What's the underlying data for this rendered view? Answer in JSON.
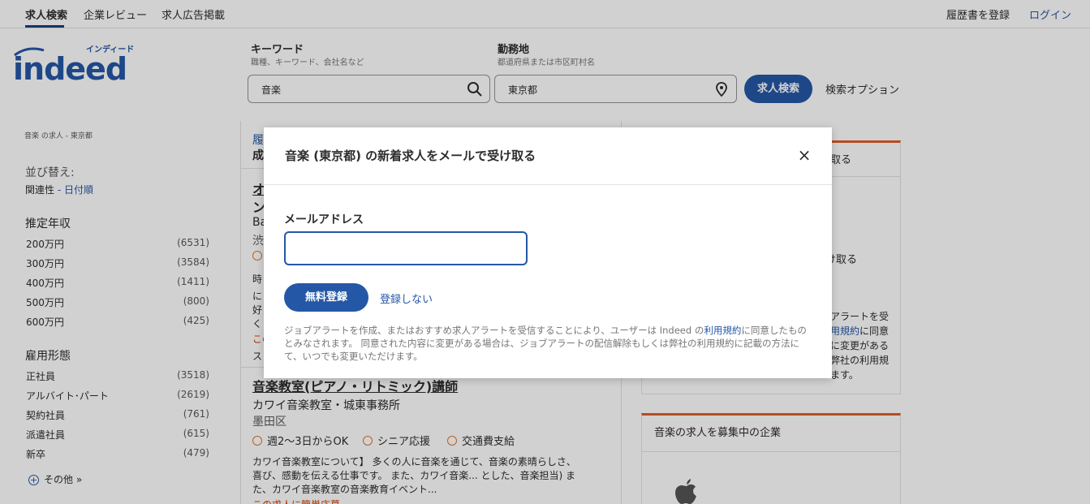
{
  "topnav": {
    "tabs": [
      "求人検索",
      "企業レビュー",
      "求人広告掲載"
    ],
    "resume_link": "履歴書を登録",
    "login_link": "ログイン"
  },
  "header": {
    "logo_text": "indeed",
    "logo_kana": "インディード",
    "keyword_label": "キーワード",
    "keyword_sub": "職種、キーワード、会社名など",
    "keyword_value": "音楽",
    "location_label": "勤務地",
    "location_sub": "都道府県または市区町村名",
    "location_value": "東京都",
    "search_button": "求人検索",
    "search_options": "検索オプション"
  },
  "sidebar": {
    "breadcrumb": "音楽 の求人 - 東京都",
    "sort_label": "並び替え:",
    "sort_current": "関連性",
    "sort_sep": " - ",
    "sort_other": "日付順",
    "salary_title": "推定年収",
    "salary": [
      {
        "label": "200万円",
        "count": "(6531)"
      },
      {
        "label": "300万円",
        "count": "(3584)"
      },
      {
        "label": "400万円",
        "count": "(1411)"
      },
      {
        "label": "500万円",
        "count": "(800)"
      },
      {
        "label": "600万円",
        "count": "(425)"
      }
    ],
    "type_title": "雇用形態",
    "types": [
      {
        "label": "正社員",
        "count": "(3518)"
      },
      {
        "label": "アルバイト･パート",
        "count": "(2619)"
      },
      {
        "label": "契約社員",
        "count": "(761)"
      },
      {
        "label": "派遣社員",
        "count": "(615)"
      },
      {
        "label": "新卒",
        "count": "(479)"
      }
    ],
    "more": "その他 »"
  },
  "jobs": {
    "top_frag_1": "履",
    "top_frag_2": "成",
    "card1_title_frag": "オ",
    "card1_title_frag2": "ン",
    "card1_company_frag": "Ba",
    "card1_loc_frag": "渋",
    "card1_snip_frag1": "時",
    "card1_snip_frag2": "に",
    "card1_snip_frag3": "好",
    "card1_snip_frag4": "く",
    "card1_apply_frag": "この",
    "card1_frag_last": "ス",
    "card2_title": "音楽教室(ピアノ・リトミック)講師",
    "card2_company": "カワイ音楽教室・城東事務所",
    "card2_location": "墨田区",
    "card2_tags": [
      "週2〜3日からOK",
      "シニア応援",
      "交通費支給"
    ],
    "card2_snippet": "カワイ音楽教室について】 多くの人に音楽を通じて、音楽の素晴らしさ、喜び、感動を伝える仕事です。 また、カワイ音楽... とした、音楽担当) また、カワイ音楽教室の音楽教育イベント...",
    "card2_apply": "この求人に簡単応募"
  },
  "right": {
    "card1_frag_a": "取る",
    "card1_frag_b": "け取る",
    "card1_frag_c": "アラートを受",
    "card1_frag_d_link": "用規約",
    "card1_frag_d": "に同意",
    "card1_frag_e": "に変更がある",
    "card1_frag_f": "弊社の利用規",
    "card1_frag_g": "ます。",
    "card2_title": "音楽の求人を募集中の企業"
  },
  "modal": {
    "title": "音楽 (東京都) の新着求人をメールで受け取る",
    "close": "×",
    "email_label": "メールアドレス",
    "email_value": "",
    "signup_button": "無料登録",
    "no_signup": "登録しない",
    "legal_1": "ジョブアラートを作成、またはおすすめ求人アラートを受信することにより、ユーザーは Indeed の",
    "legal_link": "利用規約",
    "legal_2": "に同意したものとみなされます。 同意された内容に変更がある場合は、ジョブアラートの配信解除もしくは弊社の利用規約に記載の方法にて、いつでも変更いただけます。"
  },
  "colors": {
    "brand_blue": "#2557a7",
    "accent_orange": "#e05d2a"
  }
}
